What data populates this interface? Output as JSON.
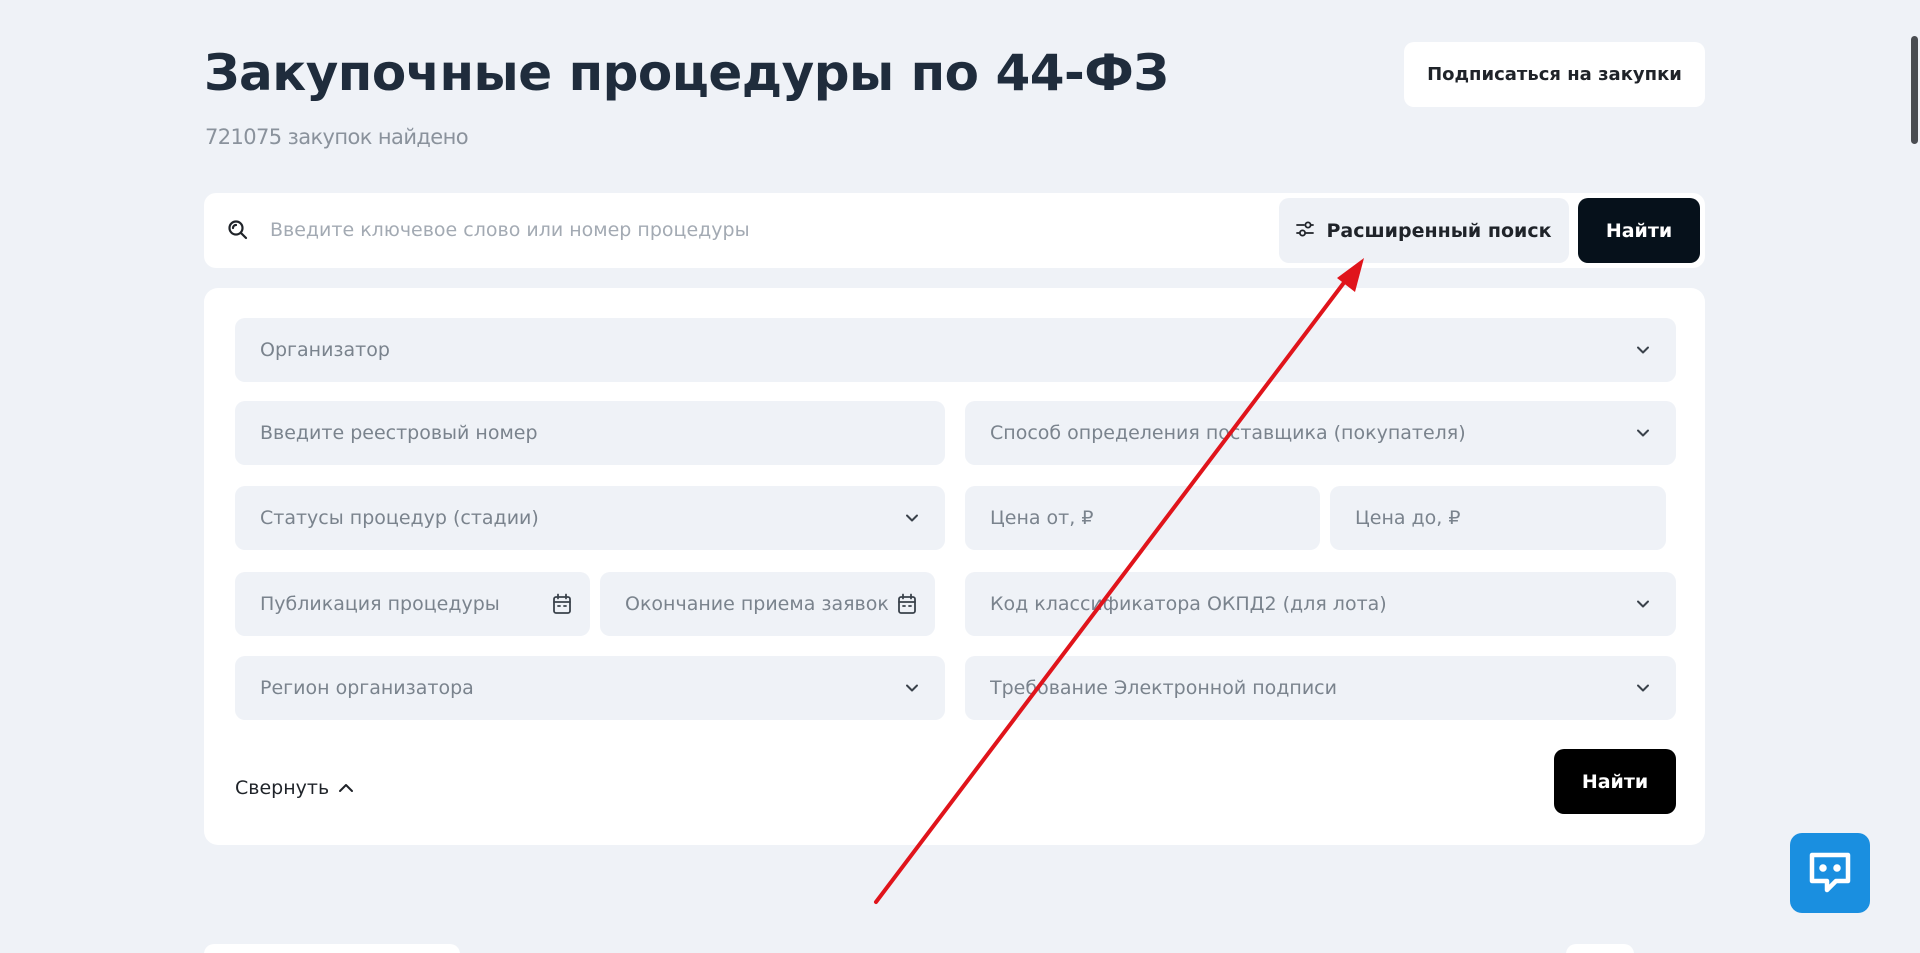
{
  "header": {
    "title": "Закупочные процедуры по 44-ФЗ",
    "count_text": "721075 закупок найдено",
    "subscribe_label": "Подписаться на закупки"
  },
  "search": {
    "placeholder": "Введите ключевое слово или номер процедуры",
    "advanced_label": "Расширенный поиск",
    "find_label": "Найти",
    "search_icon": "search-icon",
    "advanced_icon": "sliders-icon"
  },
  "filters": {
    "organizer": "Организатор",
    "registry_number": "Введите реестровый номер",
    "supplier_method": "Способ определения поставщика (покупателя)",
    "procedure_status": "Статусы процедур (стадии)",
    "price_from": "Цена от, ₽",
    "price_to": "Цена до, ₽",
    "publication_date": "Публикация процедуры",
    "deadline_date": "Окончание приема заявок",
    "okpd2_code": "Код классификатора ОКПД2 (для лота)",
    "organizer_region": "Регион организатора",
    "e_signature": "Требование Электронной подписи",
    "collapse_label": "Свернуть",
    "find_label": "Найти"
  },
  "chat": {
    "icon": "chat-icon",
    "color": "#1a8fe0"
  },
  "annotation": {
    "color": "#e0141b"
  }
}
